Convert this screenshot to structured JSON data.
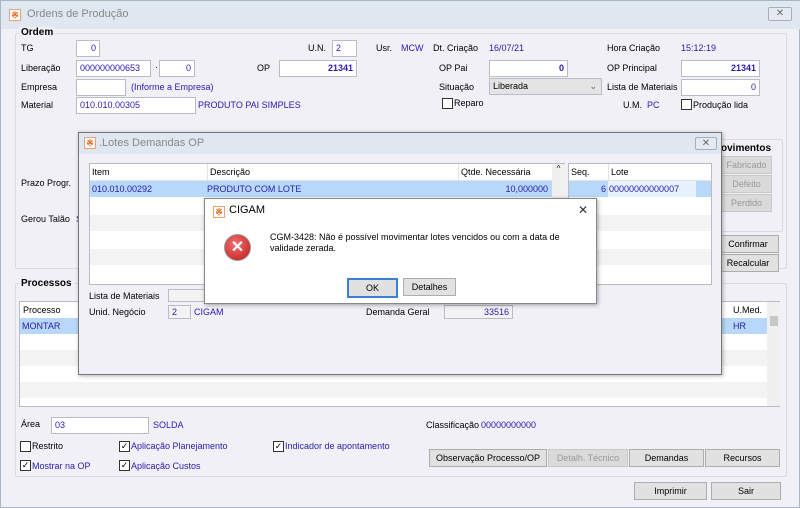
{
  "main": {
    "title": "Ordens de Produção",
    "close": "✕",
    "ordem": {
      "title": "Ordem",
      "tg_label": "TG",
      "tg": "0",
      "un_label": "U.N.",
      "un": "2",
      "usr_label": "Usr.",
      "usr": "MCW",
      "dt_label": "Dt. Criação",
      "dt": "16/07/21",
      "hora_label": "Hora Criação",
      "hora": "15:12:19",
      "liberacao_label": "Liberação",
      "liberacao": "000000000653",
      "liberacao_sep": "·",
      "liberacao_seq": "0",
      "op_label": "OP",
      "op": "21341",
      "op_pai_label": "OP Pai",
      "op_pai": "0",
      "op_principal_label": "OP Principal",
      "op_principal": "21341",
      "empresa_label": "Empresa",
      "empresa": "",
      "empresa_hint": "(Informe a Empresa)",
      "situacao_label": "Situação",
      "situacao": "Liberada",
      "lista_label": "Lista de Materiais",
      "lista": "0",
      "material_label": "Material",
      "material": "010.010.00305",
      "material_desc": "PRODUTO PAI SIMPLES",
      "reparo": "Reparo",
      "um_label": "U.M.",
      "um": "PC",
      "producao_lida": "Produção lida",
      "prazo_label": "Prazo Progr.",
      "gerou_label": "Gerou Talão",
      "gerou": "S"
    },
    "movimentos": {
      "title": "ovimentos",
      "fabricado": "Fabricado",
      "defeito": "Defeito",
      "perdido": "Perdido",
      "confirmar": "Confirmar",
      "recalcular": "Recalcular"
    },
    "processos": {
      "title": "Processos",
      "columns": [
        "Processo",
        "U.Med."
      ],
      "rows": [
        [
          "MONTAR",
          "HR"
        ]
      ]
    },
    "area_label": "Área",
    "area": "03",
    "area_desc": "SOLDA",
    "classificacao_label": "Classificação",
    "classificacao": "00000000000",
    "checks": {
      "restrito": "Restrito",
      "aplic_plan": "Aplicação Planejamento",
      "indicador": "Indicador de apontamento",
      "mostrar": "Mostrar na OP",
      "aplic_custos": "Aplicação Custos"
    },
    "buttons": {
      "observacao": "Observação Processo/OP",
      "detalh": "Detalh. Técnico",
      "demandas": "Demandas",
      "recursos": "Recursos",
      "imprimir": "Imprimir",
      "sair": "Sair"
    }
  },
  "lotes": {
    "title": ".Lotes Demandas OP",
    "close": "✕",
    "columns": [
      "Item",
      "Descrição",
      "Qtde. Necessária"
    ],
    "rows": [
      [
        "010.010.00292",
        "PRODUTO COM LOTE",
        "10,000000"
      ]
    ],
    "lote_columns": [
      "Seq.",
      "Lote"
    ],
    "lote_rows": [
      [
        "6",
        "00000000000007"
      ]
    ],
    "lista_label": "Lista de Materiais",
    "lista": "",
    "unid_label": "Unid. Negócio",
    "unid": "2",
    "unid_desc": "CIGAM",
    "demanda_label": "Demanda Geral",
    "demanda": "33516"
  },
  "msg": {
    "title": "CIGAM",
    "close": "✕",
    "text": "CGM-3428: Não é possível movimentar lotes vencidos ou com a data de validade zerada.",
    "ok": "OK",
    "detalhes": "Detalhes"
  }
}
